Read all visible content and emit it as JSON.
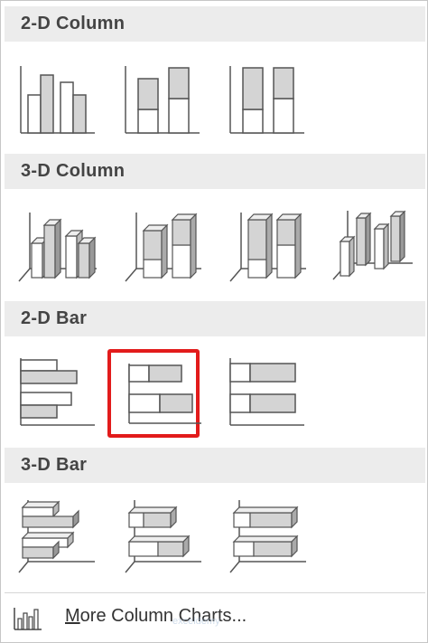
{
  "sections": [
    {
      "title": "2-D Column",
      "options": [
        "clustered-column",
        "stacked-column",
        "100-percent-stacked-column"
      ]
    },
    {
      "title": "3-D Column",
      "options": [
        "3d-clustered-column",
        "3d-stacked-column",
        "3d-100-percent-stacked-column",
        "3d-column"
      ]
    },
    {
      "title": "2-D Bar",
      "options": [
        "clustered-bar",
        "stacked-bar",
        "100-percent-stacked-bar"
      ],
      "selected": "stacked-bar"
    },
    {
      "title": "3-D Bar",
      "options": [
        "3d-clustered-bar",
        "3d-stacked-bar",
        "3d-100-percent-stacked-bar"
      ]
    }
  ],
  "more": {
    "label_first": "M",
    "label_rest": "ore Column Charts..."
  },
  "watermark": "exceldemy",
  "colors": {
    "selected_border": "#e21b1b",
    "header_bg": "#ececec",
    "bar_fill": "#d4d4d4",
    "outline": "#555555"
  }
}
